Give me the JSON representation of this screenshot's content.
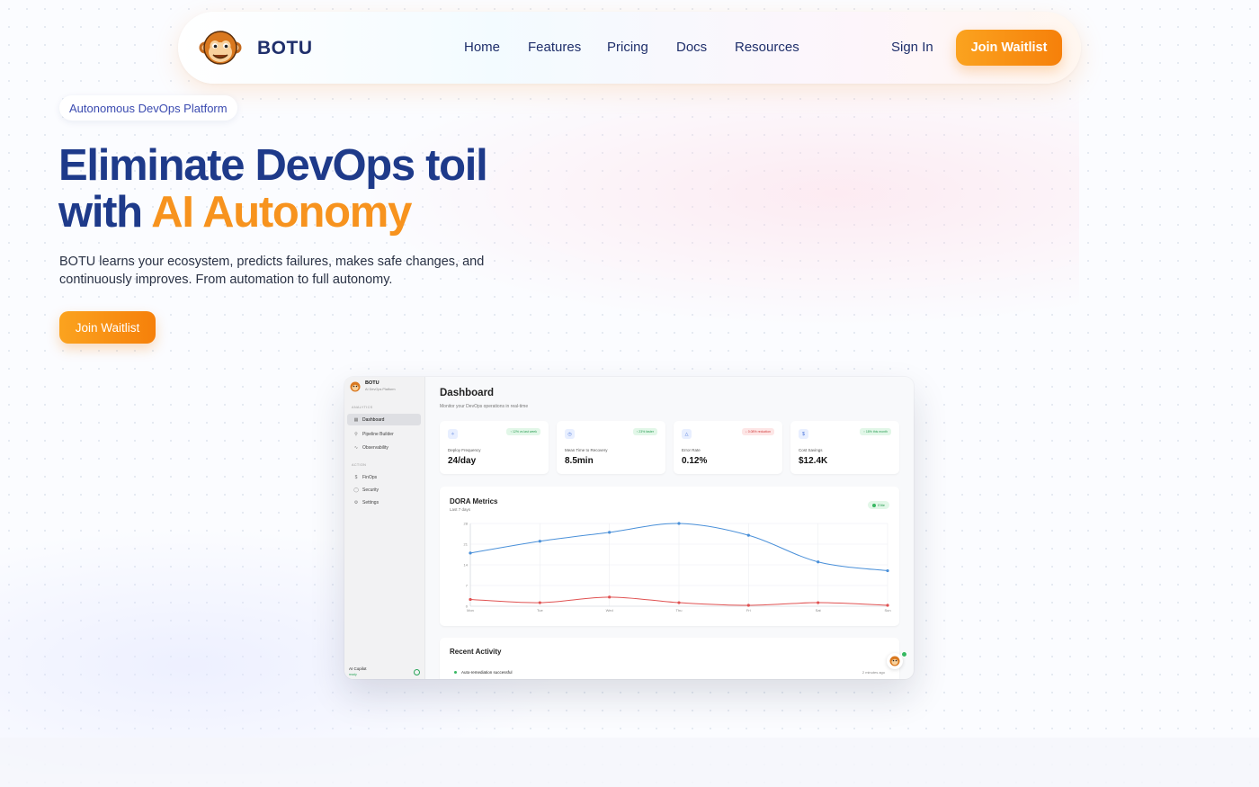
{
  "nav": {
    "brand": "BOTU",
    "links": [
      "Home",
      "Features",
      "Pricing",
      "Docs",
      "Resources"
    ],
    "sign_in": "Sign In",
    "cta": "Join Waitlist"
  },
  "hero": {
    "pill": "Autonomous DevOps Platform",
    "title_line1": "Eliminate DevOps toil",
    "title_line2_prefix": "with ",
    "title_line2_accent": "AI Autonomy",
    "subtitle": "BOTU learns your ecosystem, predicts failures, makes safe changes, and continuously improves. From automation to full autonomy.",
    "cta": "Join Waitlist"
  },
  "mock": {
    "sidebar": {
      "brand": "BOTU",
      "tagline": "AI DevOps Platform",
      "section_analytics": "ANALYTICS",
      "section_action": "ACTION",
      "items": [
        {
          "label": "Dashboard",
          "icon": "grid-icon"
        },
        {
          "label": "Pipeline Builder",
          "icon": "pipeline-icon"
        },
        {
          "label": "Observability",
          "icon": "pulse-icon"
        },
        {
          "label": "FinOps",
          "icon": "dollar-icon"
        },
        {
          "label": "Security",
          "icon": "shield-icon"
        },
        {
          "label": "Settings",
          "icon": "gear-icon"
        }
      ],
      "copilot": "AI Copilot",
      "copilot_status": "ready"
    },
    "title": "Dashboard",
    "subtitle": "Monitor your DevOps operations in real-time",
    "kpis": [
      {
        "label": "Deploy Frequency",
        "value": "24/day",
        "badge": "↑ 12% vs last week",
        "trend": "good"
      },
      {
        "label": "Mean Time to Recovery",
        "value": "8.5min",
        "badge": "↑ 23% faster",
        "trend": "good"
      },
      {
        "label": "Error Rate",
        "value": "0.12%",
        "badge": "↓ 0.08% reduction",
        "trend": "bad"
      },
      {
        "label": "Cost Savings",
        "value": "$12.4K",
        "badge": "↑ 18% this month",
        "trend": "good"
      }
    ],
    "dora": {
      "title": "DORA Metrics",
      "subtitle": "Last 7 days",
      "live": "Elite"
    },
    "activity": {
      "title": "Recent Activity",
      "item": "Auto-remediation successful",
      "time": "2 minutes ago"
    }
  },
  "chart_data": {
    "type": "line",
    "categories": [
      "Mon",
      "Tue",
      "Wed",
      "Thu",
      "Fri",
      "Sat",
      "Sun"
    ],
    "yticks": [
      0,
      7,
      14,
      21,
      28
    ],
    "ylim": [
      0,
      28
    ],
    "grid": true,
    "series": [
      {
        "color": "#4a90d9",
        "values": [
          18,
          22,
          25,
          28,
          24,
          15,
          12
        ]
      },
      {
        "color": "#e05252",
        "values": [
          2.3,
          1.2,
          3.1,
          1.2,
          0.3,
          1.2,
          0.3
        ]
      }
    ]
  }
}
